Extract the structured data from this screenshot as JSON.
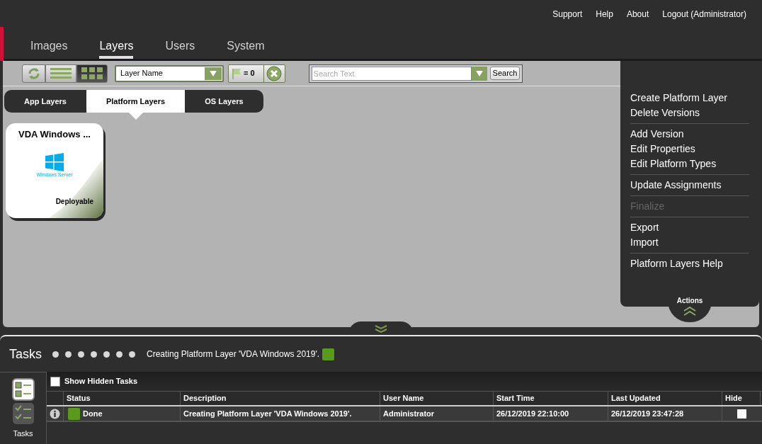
{
  "top_links": [
    "Support",
    "Help",
    "About",
    "Logout (Administrator)"
  ],
  "tabs": [
    {
      "label": "Images",
      "selected": false
    },
    {
      "label": "Layers",
      "selected": true
    },
    {
      "label": "Users",
      "selected": false
    },
    {
      "label": "System",
      "selected": false
    }
  ],
  "toolbar": {
    "view_buttons": [
      {
        "kind": "list",
        "selected": false
      },
      {
        "kind": "grid",
        "selected": true
      }
    ],
    "sort_field": "Layer Name",
    "filter_count": "= 0",
    "search": {
      "placeholder": "Search Text",
      "button": "Search"
    }
  },
  "layer_tabs": [
    {
      "label": "App Layers",
      "selected": false
    },
    {
      "label": "Platform Layers",
      "selected": true
    },
    {
      "label": "OS Layers",
      "selected": false
    }
  ],
  "layers": [
    {
      "title": "VDA Windows ...",
      "logo_text": "Windows Server",
      "status": "Deployable"
    }
  ],
  "actions": {
    "groups": [
      [
        {
          "label": "Create Platform Layer",
          "disabled": false
        },
        {
          "label": "Delete Versions",
          "disabled": false
        }
      ],
      [
        {
          "label": "Add Version",
          "disabled": false
        },
        {
          "label": "Edit Properties",
          "disabled": false
        },
        {
          "label": "Edit Platform Types",
          "disabled": false
        }
      ],
      [
        {
          "label": "Update Assignments",
          "disabled": false
        }
      ],
      [
        {
          "label": "Finalize",
          "disabled": true
        }
      ],
      [
        {
          "label": "Export",
          "disabled": false
        },
        {
          "label": "Import",
          "disabled": false
        }
      ],
      [
        {
          "label": "Platform Layers Help",
          "disabled": false
        }
      ]
    ],
    "title": "Actions"
  },
  "tasks": {
    "title": "Tasks",
    "latest": "Creating Platform Layer 'VDA Windows 2019'.",
    "sidebar_label": "Tasks",
    "show_hidden": {
      "label": "Show Hidden Tasks",
      "checked": false
    },
    "columns": [
      "Status",
      "Description",
      "User Name",
      "Start Time",
      "Last Updated",
      "Hide"
    ],
    "rows": [
      {
        "status": "Done",
        "description": "Creating Platform Layer 'VDA Windows 2019'.",
        "user": "Administrator",
        "start": "26/12/2019 22:10:00",
        "updated": "26/12/2019 23:47:28",
        "hidden": false
      }
    ]
  }
}
